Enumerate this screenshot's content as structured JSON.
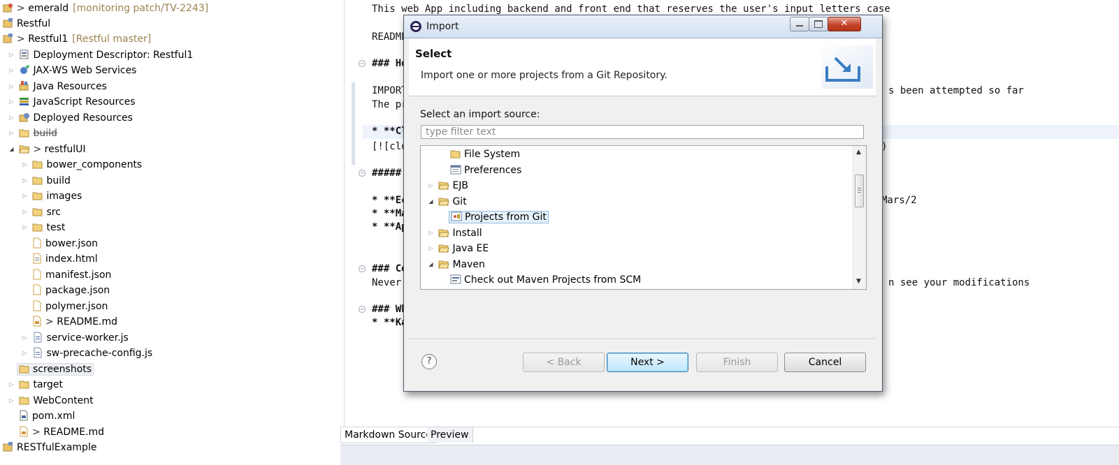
{
  "explorer": {
    "items": [
      {
        "prefix": "> ",
        "label": "emerald",
        "decoration": "[monitoring patch/TV-2243]",
        "icon": "git-project-icon"
      },
      {
        "prefix": "",
        "label": "Restful",
        "decoration": "",
        "icon": "project-icon"
      },
      {
        "prefix": "> ",
        "label": "Restful1",
        "decoration": "[Restful master]",
        "icon": "git-project-icon"
      },
      {
        "label": "Deployment Descriptor: Restful1"
      },
      {
        "label": "JAX-WS Web Services"
      },
      {
        "label": "Java Resources"
      },
      {
        "label": "JavaScript Resources"
      },
      {
        "label": "Deployed Resources"
      },
      {
        "label": "build"
      },
      {
        "prefix": "> ",
        "label": "restfulUI"
      },
      {
        "label": "bower_components"
      },
      {
        "label": "build"
      },
      {
        "label": "images"
      },
      {
        "label": "src"
      },
      {
        "label": "test"
      },
      {
        "label": "bower.json"
      },
      {
        "label": "index.html"
      },
      {
        "label": "manifest.json"
      },
      {
        "label": "package.json"
      },
      {
        "label": "polymer.json"
      },
      {
        "prefix": "> ",
        "label": "README.md"
      },
      {
        "label": "service-worker.js"
      },
      {
        "label": "sw-precache-config.js"
      },
      {
        "label": "screenshots"
      },
      {
        "label": "target"
      },
      {
        "label": "WebContent"
      },
      {
        "label": "pom.xml"
      },
      {
        "prefix": "> ",
        "label": "README.md"
      },
      {
        "label": "RESTfulExample"
      }
    ]
  },
  "editor": {
    "lines": [
      "This web App including backend and front end that reserves the user's input letters case",
      "README",
      "### Hou",
      "IMPORTA",
      "s been attempted so far",
      "The pro",
      "* **Cle",
      "[![clo",
      ")",
      "##### R",
      "* **Ecl",
      "Mars/2",
      "* **Mav",
      "* **App",
      "### Con",
      "Never r",
      "n see your modifications",
      "### Whe",
      "* **Kas"
    ],
    "tabs": {
      "source": "Markdown Source",
      "preview": "Preview"
    }
  },
  "dialog": {
    "title": "Import",
    "close_glyph": "✕",
    "banner_title": "Select",
    "banner_desc": "Import one or more projects from a Git Repository.",
    "source_label": "Select an import source:",
    "filter_placeholder": "type filter text",
    "tree": [
      {
        "label": "File System"
      },
      {
        "label": "Preferences"
      },
      {
        "label": "EJB"
      },
      {
        "label": "Git"
      },
      {
        "label": "Projects from Git",
        "selected": true
      },
      {
        "label": "Install"
      },
      {
        "label": "Java EE"
      },
      {
        "label": "Maven"
      },
      {
        "label": "Check out Maven Projects from SCM"
      }
    ],
    "help_glyph": "?",
    "buttons": {
      "back": "< Back",
      "next": "Next >",
      "finish": "Finish",
      "cancel": "Cancel"
    }
  },
  "colors": {
    "accent": "#3c7fb1",
    "selection": "#e5f1fb",
    "close_button": "#c4432a",
    "git_decoration": "#9c8250"
  }
}
